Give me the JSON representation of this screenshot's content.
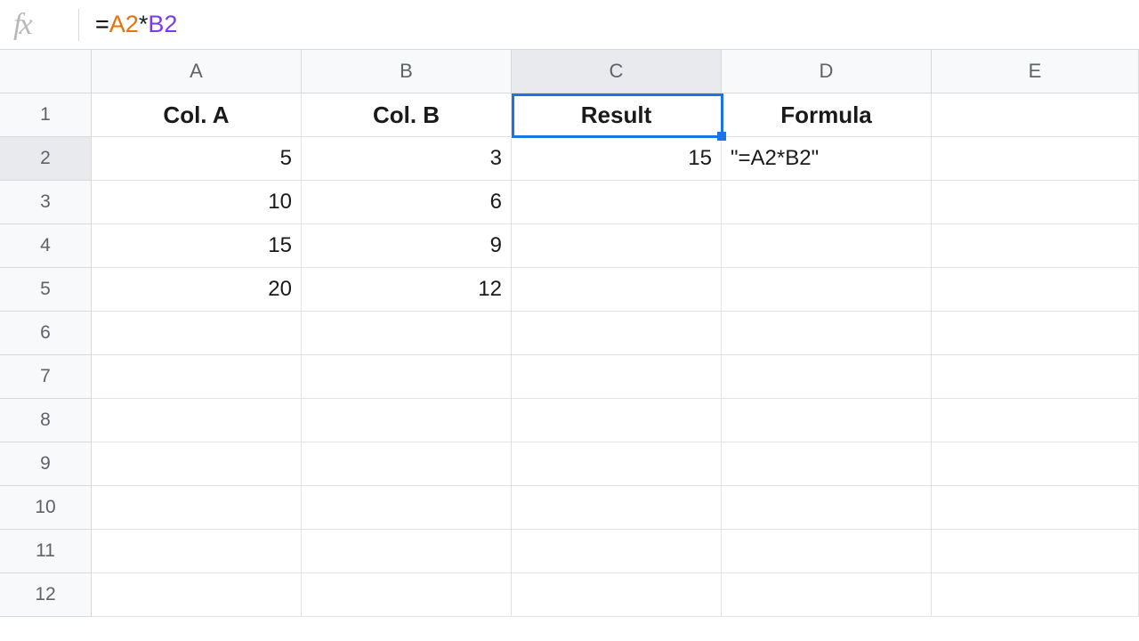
{
  "formula_bar": {
    "fx_label": "fx",
    "tokens": {
      "eq": "=",
      "ref1": "A2",
      "op": "*",
      "ref2": "B2"
    }
  },
  "columns": [
    "A",
    "B",
    "C",
    "D",
    "E"
  ],
  "rows": [
    "1",
    "2",
    "3",
    "4",
    "5",
    "6",
    "7",
    "8",
    "9",
    "10",
    "11",
    "12"
  ],
  "selected": {
    "col": "C",
    "row": "2"
  },
  "cells": {
    "A1": "Col. A",
    "B1": "Col. B",
    "C1": "Result",
    "D1": "Formula",
    "A2": "5",
    "B2": "3",
    "C2": "15",
    "D2": "\"=A2*B2\"",
    "A3": "10",
    "B3": "6",
    "A4": "15",
    "B4": "9",
    "A5": "20",
    "B5": "12"
  },
  "chart_data": {
    "type": "table",
    "title": "",
    "columns": [
      "Col. A",
      "Col. B",
      "Result",
      "Formula"
    ],
    "rows": [
      [
        5,
        3,
        15,
        "=A2*B2"
      ],
      [
        10,
        6,
        null,
        null
      ],
      [
        15,
        9,
        null,
        null
      ],
      [
        20,
        12,
        null,
        null
      ]
    ]
  }
}
